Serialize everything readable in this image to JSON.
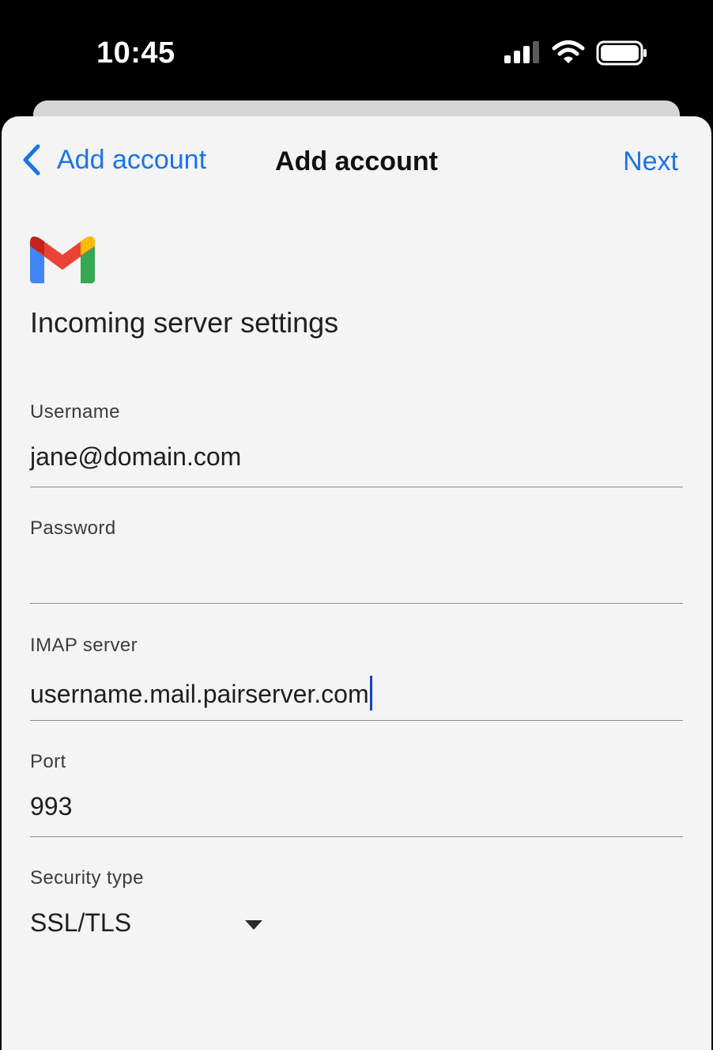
{
  "status_bar": {
    "time": "10:45",
    "icons": [
      "signal-icon",
      "wifi-icon",
      "battery-icon"
    ]
  },
  "nav": {
    "back_label": "Add account",
    "title": "Add account",
    "next_label": "Next"
  },
  "logo": "gmail-logo",
  "section_title": "Incoming server settings",
  "fields": {
    "username": {
      "label": "Username",
      "value": "jane@domain.com"
    },
    "password": {
      "label": "Password",
      "value": ""
    },
    "imap_server": {
      "label": "IMAP server",
      "value": "username.mail.pairserver.com"
    },
    "port": {
      "label": "Port",
      "value": "993"
    },
    "security_type": {
      "label": "Security type",
      "value": "SSL/TLS"
    }
  },
  "colors": {
    "accent": "#1a73e8",
    "sheet_background": "#f3f4f3",
    "text": "#1f1f1f"
  }
}
